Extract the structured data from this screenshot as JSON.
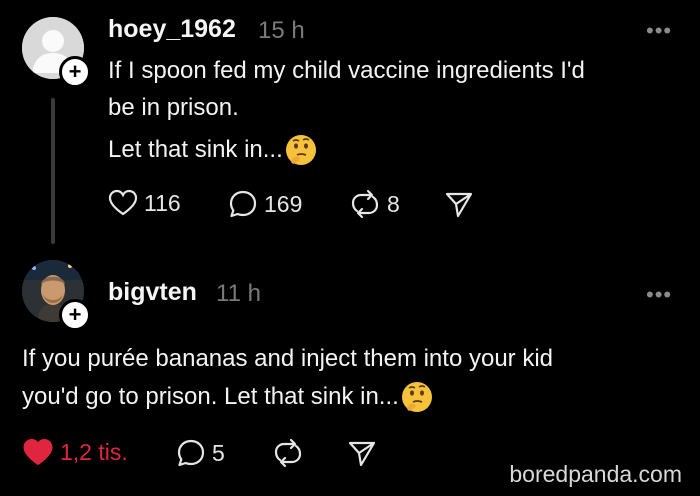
{
  "posts": [
    {
      "username": "hoey_1962",
      "time": "15 h",
      "lines": [
        "If I spoon fed my child vaccine ingredients I'd",
        "be in prison.",
        "Let that sink in..."
      ],
      "likes": "116",
      "replies": "169",
      "reposts": "8"
    },
    {
      "username": "bigvten",
      "time": "11 h",
      "lines": [
        "If you purée bananas and inject them into your kid",
        "you'd go to prison. Let that sink in..."
      ],
      "likes": "1,2 tis.",
      "replies": "5",
      "liked": true
    }
  ],
  "icons": {
    "like": "heart-icon",
    "reply": "speech-bubble-icon",
    "repost": "repost-icon",
    "share": "send-icon",
    "more": "more-dots-icon",
    "follow": "plus-icon",
    "emoji": "thinking-face-emoji"
  },
  "colors": {
    "background": "#000000",
    "liked": "#e0263f",
    "muted": "#7a7a7a"
  },
  "watermark": "boredpanda.com"
}
